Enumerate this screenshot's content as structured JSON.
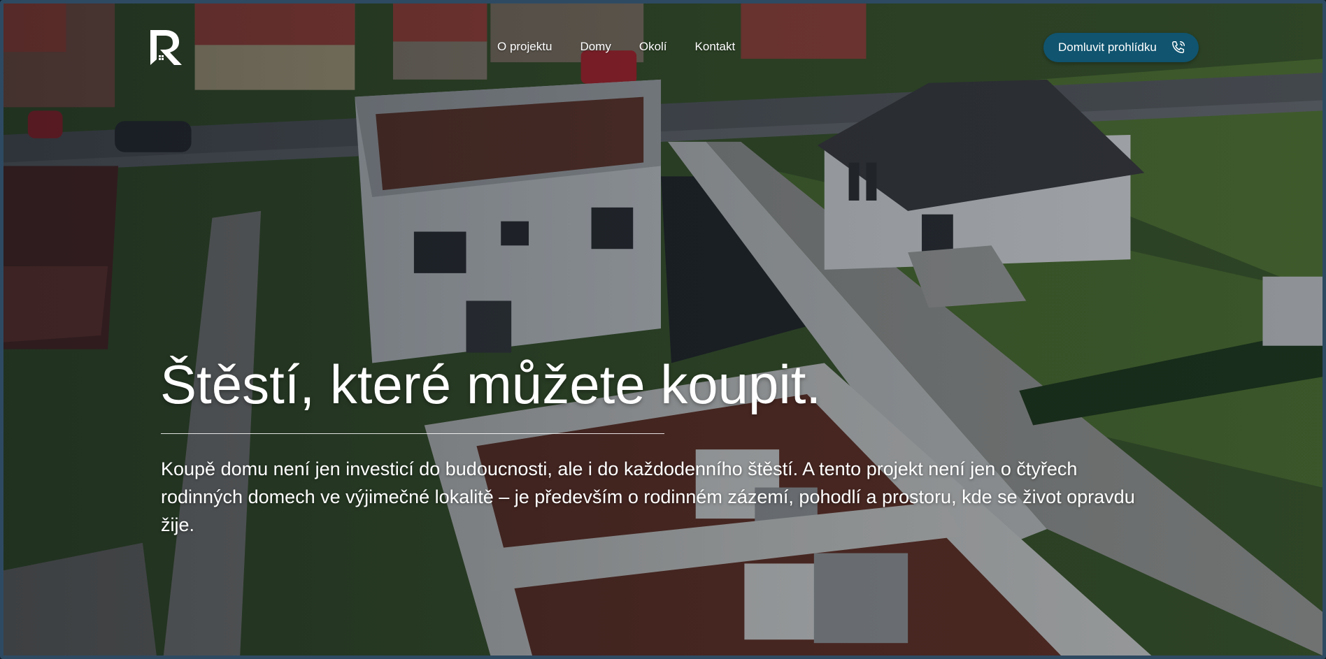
{
  "brand": {
    "logo_letter": "R"
  },
  "nav": {
    "items": [
      {
        "label": "O projektu"
      },
      {
        "label": "Domy"
      },
      {
        "label": "Okolí"
      },
      {
        "label": "Kontakt"
      }
    ]
  },
  "cta": {
    "label": "Domluvit prohlídku",
    "icon": "phone-icon",
    "color": "#10546f"
  },
  "hero": {
    "title": "Štěstí, které můžete koupit.",
    "text": "Koupě domu není jen investicí do budoucnosti, ale i do každodenního štěstí. A tento projekt není jen o čtyřech rodinných domech ve výjimečné lokalitě – je především o rodinném zázemí, pohodlí a prostoru, kde se život opravdu žije."
  }
}
